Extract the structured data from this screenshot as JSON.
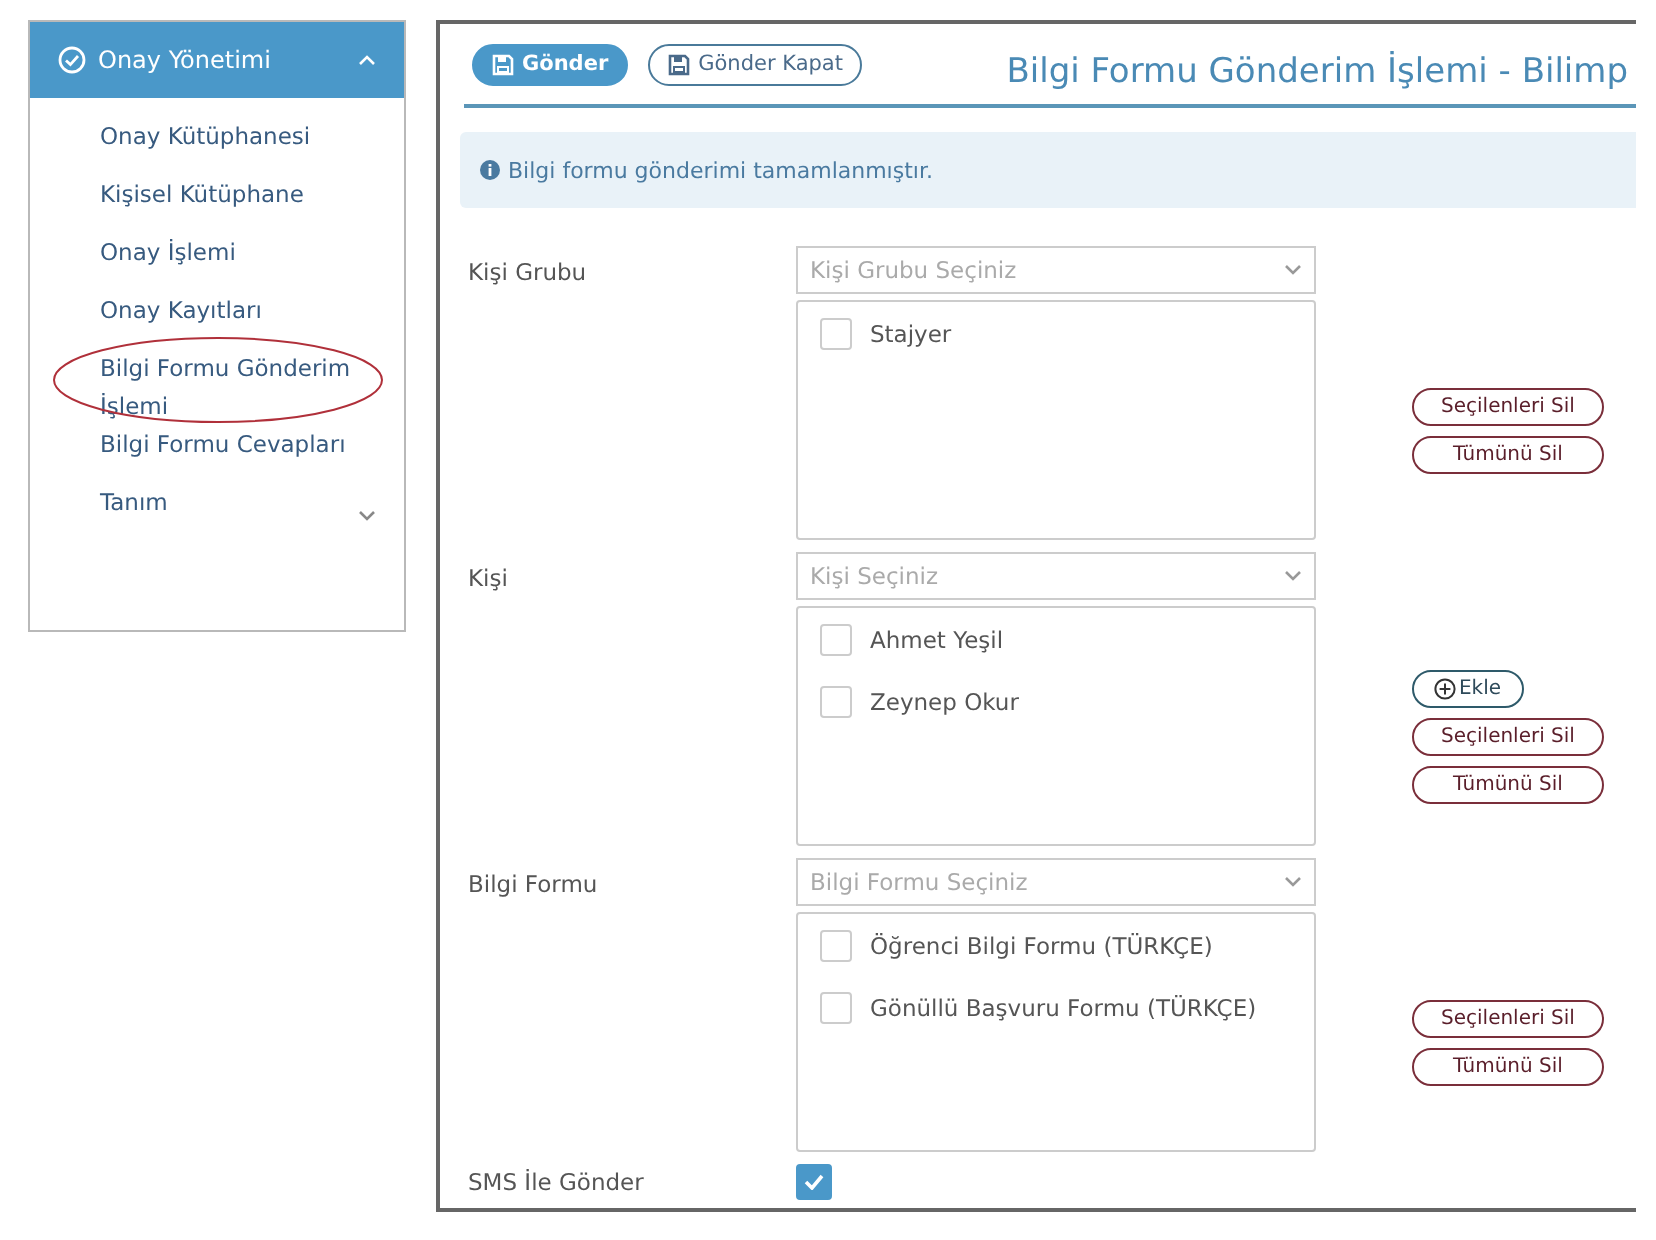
{
  "sidebar": {
    "header": {
      "label": "Onay Yönetimi",
      "expanded": true
    },
    "items": [
      {
        "label": "Onay Kütüphanesi",
        "highlighted": false,
        "has_children": false
      },
      {
        "label": "Kişisel Kütüphane",
        "highlighted": false,
        "has_children": false
      },
      {
        "label": "Onay İşlemi",
        "highlighted": false,
        "has_children": false
      },
      {
        "label": "Onay Kayıtları",
        "highlighted": false,
        "has_children": false
      },
      {
        "label": "Bilgi Formu Gönderim İşlemi",
        "highlighted": true,
        "has_children": false
      },
      {
        "label": "Bilgi Formu Cevapları",
        "highlighted": false,
        "has_children": false
      },
      {
        "label": "Tanım",
        "highlighted": false,
        "has_children": true
      }
    ]
  },
  "toolbar": [
    {
      "label": "Gönder",
      "kind": "primary"
    },
    {
      "label": "Gönder Kapat",
      "kind": "outline"
    }
  ],
  "title": "Bilgi Formu Gönderim İşlemi - Bilimp",
  "alert": "Bilgi formu gönderimi tamamlanmıştır.",
  "sections": [
    {
      "label": "Kişi Grubu",
      "placeholder": "Kişi Grubu Seçiniz",
      "items": [
        {
          "label": "Stajyer",
          "checked": false
        }
      ],
      "buttons": [
        {
          "label": "Seçilenleri Sil",
          "kind": "remove"
        },
        {
          "label": "Tümünü Sil",
          "kind": "remove"
        }
      ]
    },
    {
      "label": "Kişi",
      "placeholder": "Kişi Seçiniz",
      "items": [
        {
          "label": "Ahmet Yeşil",
          "checked": false
        },
        {
          "label": "Zeynep Okur",
          "checked": false
        }
      ],
      "buttons": [
        {
          "label": "Ekle",
          "kind": "add"
        },
        {
          "label": "Seçilenleri Sil",
          "kind": "remove"
        },
        {
          "label": "Tümünü Sil",
          "kind": "remove"
        }
      ]
    },
    {
      "label": "Bilgi Formu",
      "placeholder": "Bilgi Formu Seçiniz",
      "items": [
        {
          "label": "Öğrenci Bilgi Formu (TÜRKÇE)",
          "checked": false
        },
        {
          "label": "Gönüllü Başvuru Formu (TÜRKÇE)",
          "checked": false
        }
      ],
      "buttons": [
        {
          "label": "Seçilenleri Sil",
          "kind": "remove"
        },
        {
          "label": "Tümünü Sil",
          "kind": "remove"
        }
      ]
    }
  ],
  "sms": {
    "label": "SMS İle Gönder",
    "checked": true
  }
}
